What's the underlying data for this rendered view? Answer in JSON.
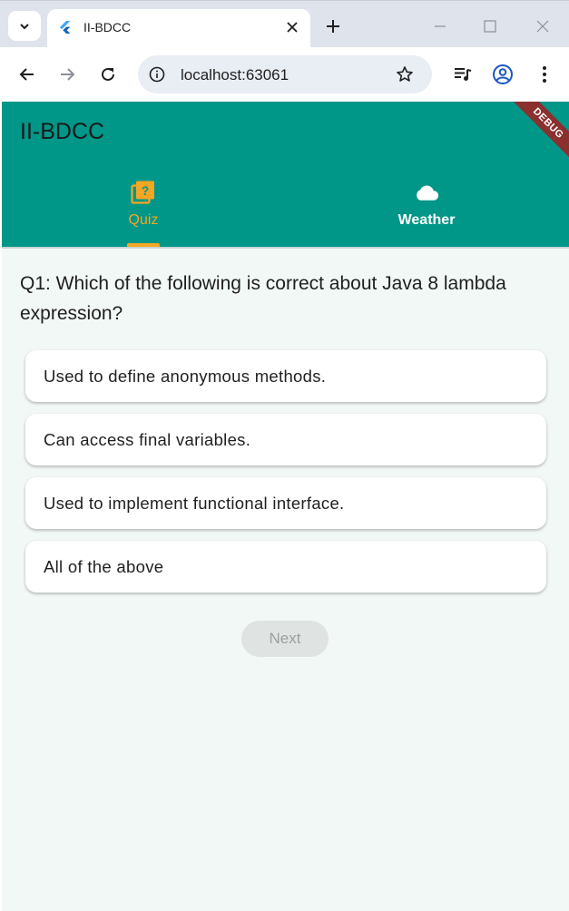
{
  "browser": {
    "tab_title": "II-BDCC",
    "url": "localhost:63061"
  },
  "app": {
    "title": "II-BDCC",
    "debug_label": "DEBUG",
    "tabs": [
      {
        "label": "Quiz",
        "icon": "quiz-icon",
        "active": true
      },
      {
        "label": "Weather",
        "icon": "cloud-icon",
        "active": false
      }
    ]
  },
  "quiz": {
    "question": "Q1: Which of the following is correct about Java 8 lambda expression?",
    "options": [
      "Used to define anonymous methods.",
      "Can access final variables.",
      "Used to implement functional interface.",
      "All of the above"
    ],
    "next_label": "Next"
  },
  "colors": {
    "appbar": "#009688",
    "accent": "#f5a623",
    "debug_ribbon": "#8b2f2f",
    "background": "#f2f8f6"
  }
}
